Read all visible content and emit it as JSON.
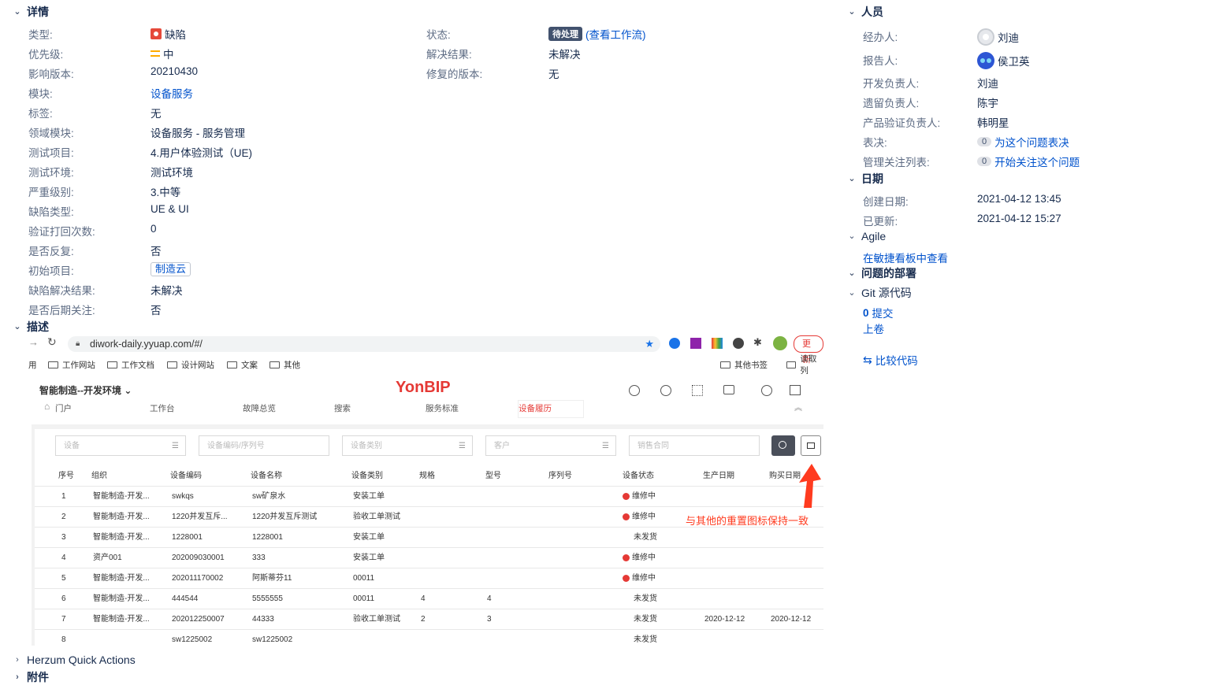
{
  "sections": {
    "details": "详情",
    "description": "描述",
    "people": "人员",
    "dates": "日期",
    "agile": "Agile",
    "deployment": "问题的部署",
    "git": "Git 源代码",
    "herzum": "Herzum Quick Actions",
    "attachments": "附件"
  },
  "details_left": [
    {
      "label": "类型:",
      "value": "缺陷"
    },
    {
      "label": "优先级:",
      "value": "中"
    },
    {
      "label": "影响版本:",
      "value": "20210430"
    },
    {
      "label": "模块:",
      "value": "设备服务"
    },
    {
      "label": "标签:",
      "value": "无"
    },
    {
      "label": "领域模块:",
      "value": "设备服务 - 服务管理"
    },
    {
      "label": "测试项目:",
      "value": "4.用户体验测试（UE)"
    },
    {
      "label": "测试环境:",
      "value": "测试环境"
    },
    {
      "label": "严重级别:",
      "value": "3.中等"
    },
    {
      "label": "缺陷类型:",
      "value": "UE & UI"
    },
    {
      "label": "验证打回次数:",
      "value": "0"
    },
    {
      "label": "是否反复:",
      "value": "否"
    },
    {
      "label": "初始项目:",
      "value": "制造云"
    },
    {
      "label": "缺陷解决结果:",
      "value": "未解决"
    },
    {
      "label": "是否后期关注:",
      "value": "否"
    }
  ],
  "details_right": {
    "status_label": "状态:",
    "status_value": "待处理",
    "workflow_link": "(查看工作流)",
    "resolution_label": "解决结果:",
    "resolution_value": "未解决",
    "fixver_label": "修复的版本:",
    "fixver_value": "无"
  },
  "people": [
    {
      "label": "经办人:",
      "value": "刘迪"
    },
    {
      "label": "报告人:",
      "value": "侯卫英"
    },
    {
      "label": "开发负责人:",
      "value": "刘迪"
    },
    {
      "label": "遗留负责人:",
      "value": "陈宇"
    },
    {
      "label": "产品验证负责人:",
      "value": "韩明星"
    },
    {
      "label": "表决:",
      "count": "0",
      "value": "为这个问题表决"
    },
    {
      "label": "管理关注列表:",
      "count": "0",
      "value": "开始关注这个问题"
    }
  ],
  "dates": {
    "created_label": "创建日期:",
    "created_value": "2021-04-12 13:45",
    "updated_label": "已更新:",
    "updated_value": "2021-04-12 15:27"
  },
  "agile_link": "在敏捷看板中查看",
  "git": {
    "commits_count": "0",
    "commits_label": "提交",
    "shelve": "上卷",
    "compare": "比较代码"
  },
  "shot": {
    "url": "diwork-daily.yyuap.com/#/",
    "update_btn": "更新",
    "bookmarks": [
      "用",
      "工作网站",
      "工作文档",
      "设计网站",
      "文案",
      "其他"
    ],
    "bookmarks_right": [
      "其他书签",
      "读取列"
    ],
    "env": "智能制造--开发环境",
    "logo": "YonBIP",
    "tabs": [
      "门户",
      "工作台",
      "故障总览",
      "搜索",
      "服务标准",
      "设备履历"
    ],
    "filters": [
      "设备",
      "设备编码/序列号",
      "设备类别",
      "客户",
      "销售合同"
    ],
    "annotation": "与其他的重置图标保持一致",
    "headers": [
      "序号",
      "组织",
      "设备编码",
      "设备名称",
      "设备类别",
      "规格",
      "型号",
      "序列号",
      "设备状态",
      "生产日期",
      "购买日期"
    ],
    "rows": [
      [
        "1",
        "智能制造-开发...",
        "swkqs",
        "sw矿泉水",
        "安装工单",
        "",
        "",
        "",
        "维修中",
        "",
        ""
      ],
      [
        "2",
        "智能制造-开发...",
        "1220并发互斥...",
        "1220并发互斥测试",
        "验收工单测试",
        "",
        "",
        "",
        "维修中",
        "",
        ""
      ],
      [
        "3",
        "智能制造-开发...",
        "1228001",
        "1228001",
        "安装工单",
        "",
        "",
        "",
        "未发货",
        "",
        ""
      ],
      [
        "4",
        "资产001",
        "202009030001",
        "333",
        "安装工单",
        "",
        "",
        "",
        "维修中",
        "",
        ""
      ],
      [
        "5",
        "智能制造-开发...",
        "202011170002",
        "阿斯蒂芬11",
        "00011",
        "",
        "",
        "",
        "维修中",
        "",
        ""
      ],
      [
        "6",
        "智能制造-开发...",
        "444544",
        "5555555",
        "00011",
        "4",
        "4",
        "",
        "未发货",
        "",
        ""
      ],
      [
        "7",
        "智能制造-开发...",
        "202012250007",
        "44333",
        "验收工单测试",
        "2",
        "3",
        "",
        "未发货",
        "2020-12-12",
        "2020-12-12"
      ],
      [
        "8",
        "",
        "sw1225002",
        "sw1225002",
        "",
        "",
        "",
        "",
        "未发货",
        "",
        ""
      ]
    ]
  }
}
